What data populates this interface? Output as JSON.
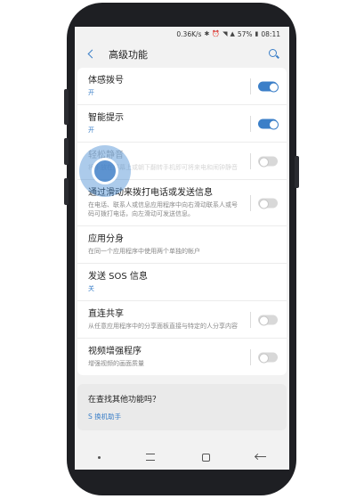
{
  "status_bar": {
    "speed": "0.36K/s",
    "battery": "57%",
    "time": "08:11"
  },
  "app_bar": {
    "title": "高级功能"
  },
  "items": [
    {
      "title": "体感拨号",
      "subtitle": "开",
      "toggle": "on"
    },
    {
      "title": "智能提示",
      "subtitle": "开",
      "toggle": "on"
    },
    {
      "title": "轻松静音",
      "subtitle": "将手放在屏幕上或朝下翻转手机即可将来电和闹钟静音",
      "toggle": "off"
    },
    {
      "title": "通过滑动来拨打电话或发送信息",
      "subtitle": "在电话、联系人或信息应用程序中向右滑动联系人或号码可拨打电话，向左滑动可发送信息。",
      "toggle": "off"
    },
    {
      "title": "应用分身",
      "subtitle": "在同一个应用程序中使用两个单独的帐户"
    },
    {
      "title": "发送 SOS 信息",
      "subtitle": "关"
    },
    {
      "title": "直连共享",
      "subtitle": "从任意应用程序中的分享面板直接与特定的人分享内容",
      "toggle": "off"
    },
    {
      "title": "视频增强程序",
      "subtitle": "增强视频的画面质量",
      "toggle": "off"
    }
  ],
  "suggestion": {
    "title": "在查找其他功能吗？",
    "link": "S 换机助手"
  }
}
